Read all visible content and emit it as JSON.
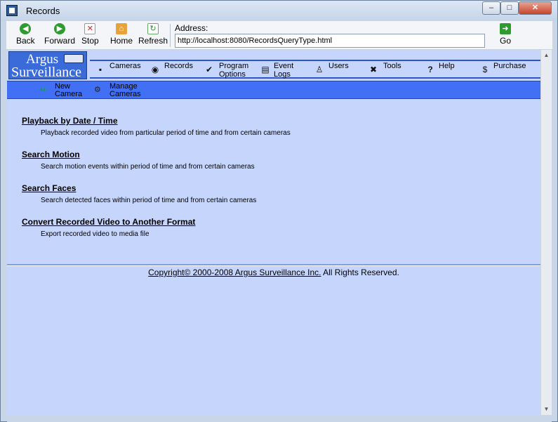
{
  "window": {
    "title": "Records"
  },
  "toolbar": {
    "back_label": "Back",
    "forward_label": "Forward",
    "stop_label": "Stop",
    "home_label": "Home",
    "refresh_label": "Refresh",
    "address_label": "Address:",
    "address_value": "http://localhost:8080/RecordsQueryType.html",
    "go_label": "Go"
  },
  "logo": {
    "line1": "Argus",
    "line2": "Surveillance"
  },
  "nav": {
    "items": [
      {
        "label": "Cameras",
        "icon": "camera-icon"
      },
      {
        "label": "Records",
        "icon": "disc-icon"
      },
      {
        "label": "Program\nOptions",
        "icon": "checkmark-icon"
      },
      {
        "label": "Event\nLogs",
        "icon": "document-icon"
      },
      {
        "label": "Users",
        "icon": "users-icon"
      },
      {
        "label": "Tools",
        "icon": "tools-icon"
      },
      {
        "label": "Help",
        "icon": "question-icon"
      },
      {
        "label": "Purchase",
        "icon": "dollar-icon"
      }
    ]
  },
  "subnav": {
    "items": [
      {
        "label": "New\nCamera",
        "icon": "new-camera-icon"
      },
      {
        "label": "Manage\nCameras",
        "icon": "manage-cameras-icon"
      }
    ]
  },
  "entries": [
    {
      "title": "Playback by Date / Time",
      "desc": "Playback recorded video from particular period of time and from certain cameras"
    },
    {
      "title": "Search Motion",
      "desc": "Search motion events within period of time and from certain cameras"
    },
    {
      "title": "Search Faces",
      "desc": "Search detected faces within period of time and from certain cameras"
    },
    {
      "title": "Convert Recorded Video to Another Format",
      "desc": "Export recorded video to media file"
    }
  ],
  "footer": {
    "copyright_link": "Copyright© 2000-2008 Argus Surveillance Inc.",
    "rights": " All Rights Reserved."
  }
}
